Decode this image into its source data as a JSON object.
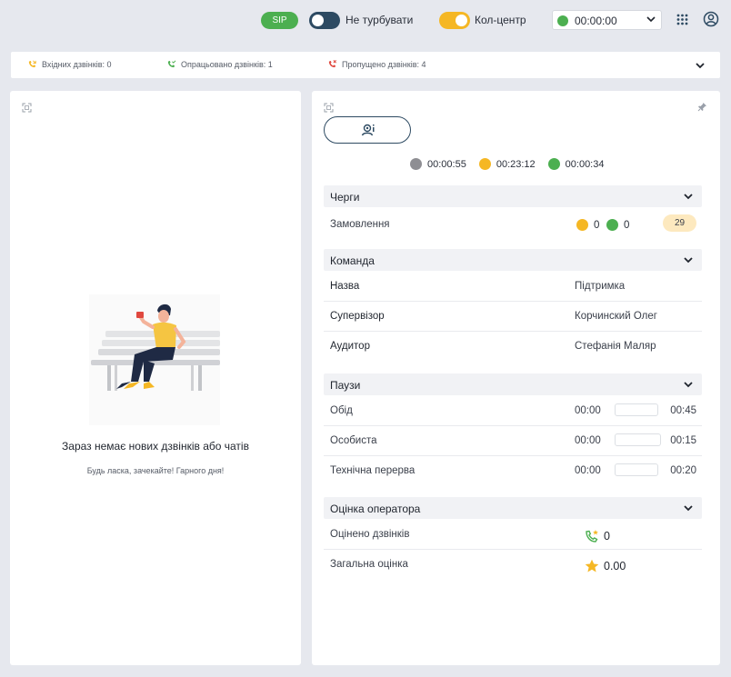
{
  "topbar": {
    "sip_label": "SIP",
    "dnd_label": "Не турбувати",
    "callcenter_label": "Кол-центр",
    "status_time": "00:00:00",
    "colors": {
      "green": "#4caf50",
      "navy": "#2d4a62",
      "yellow": "#f5b724"
    },
    "dnd_on": false,
    "callcenter_on": true
  },
  "stats": {
    "incoming": "Вхідних дзвінків: 0",
    "processed": "Опрацьовано дзвінків: 1",
    "missed": "Пропущено дзвінків: 4"
  },
  "left": {
    "empty_title": "Зараз немає нових дзвінків або чатів",
    "empty_subtitle": "Будь ласка, зачекайте! Гарного дня!"
  },
  "right": {
    "timers": [
      {
        "color": "#8e8e93",
        "value": "00:00:55"
      },
      {
        "color": "#f5b724",
        "value": "00:23:12"
      },
      {
        "color": "#4caf50",
        "value": "00:00:34"
      }
    ],
    "queues": {
      "title": "Черги",
      "items": [
        {
          "name": "Замовлення",
          "yellow": "0",
          "green": "0",
          "badge": "29"
        }
      ]
    },
    "team": {
      "title": "Команда",
      "rows": [
        {
          "key": "Назва",
          "value": "Підтримка"
        },
        {
          "key": "Супервізор",
          "value": "Корчинский Олег"
        },
        {
          "key": "Аудитор",
          "value": "Стефанія Маляр"
        }
      ]
    },
    "pauses": {
      "title": "Паузи",
      "rows": [
        {
          "key": "Обід",
          "used": "00:00",
          "limit": "00:45"
        },
        {
          "key": "Особиста",
          "used": "00:00",
          "limit": "00:15"
        },
        {
          "key": "Технічна перерва",
          "used": "00:00",
          "limit": "00:20"
        }
      ]
    },
    "rating": {
      "title": "Оцінка оператора",
      "rows": [
        {
          "key": "Оцінено дзвінків",
          "value": "0",
          "icon": "phone-star-icon"
        },
        {
          "key": "Загальна оцінка",
          "value": "0.00",
          "icon": "star-icon"
        }
      ]
    }
  }
}
